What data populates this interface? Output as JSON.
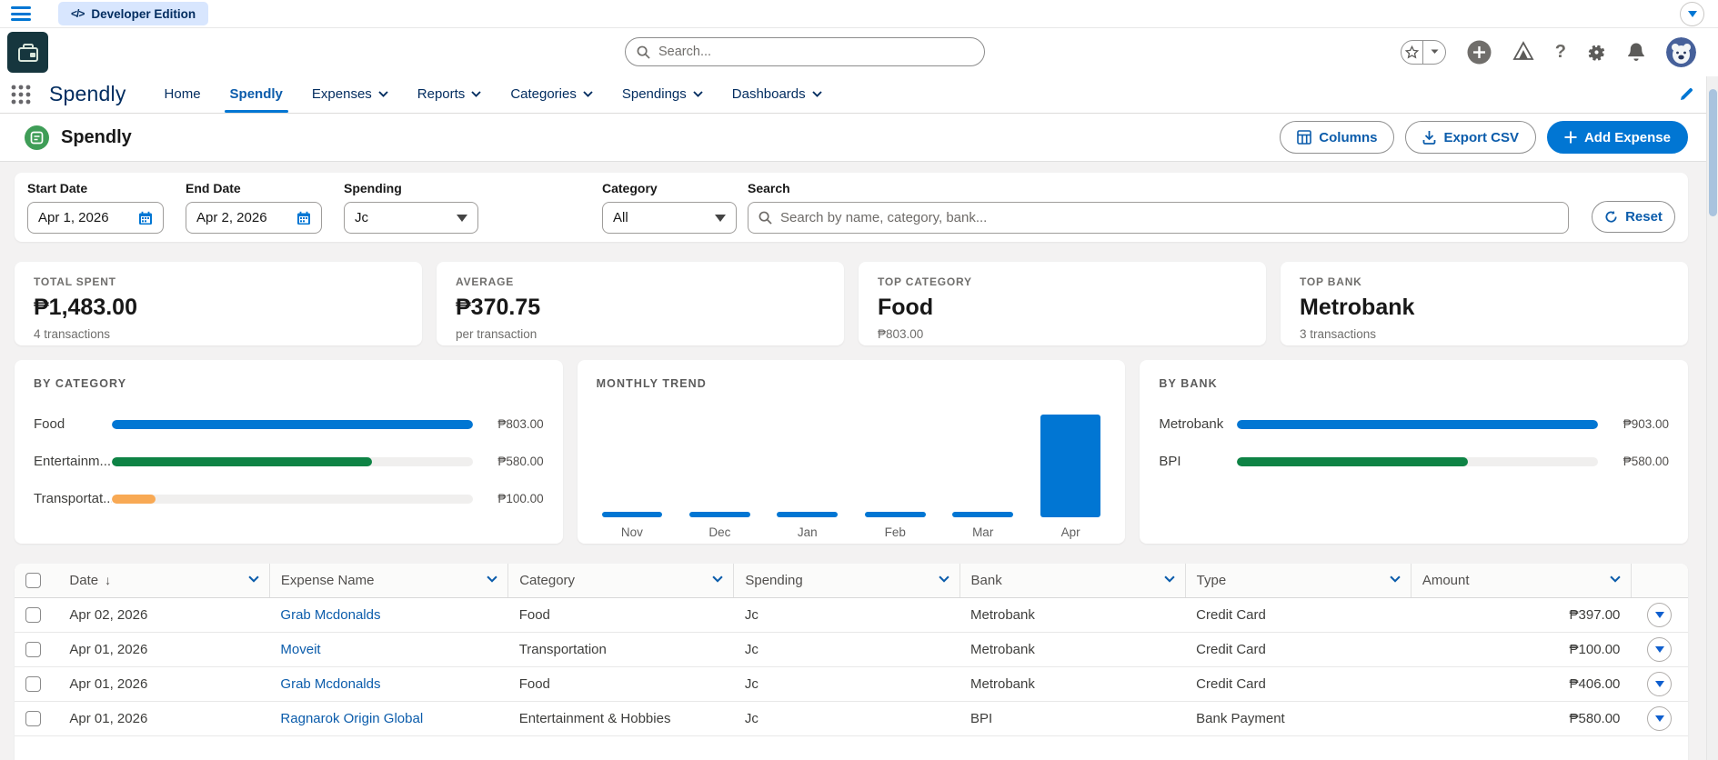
{
  "top_bar": {
    "developer_edition_label": "Developer Edition"
  },
  "global_header": {
    "search_placeholder": "Search..."
  },
  "nav": {
    "app_name": "Spendly",
    "tabs": [
      {
        "label": "Home",
        "active": false,
        "has_menu": false
      },
      {
        "label": "Spendly",
        "active": true,
        "has_menu": false
      },
      {
        "label": "Expenses",
        "active": false,
        "has_menu": true
      },
      {
        "label": "Reports",
        "active": false,
        "has_menu": true
      },
      {
        "label": "Categories",
        "active": false,
        "has_menu": true
      },
      {
        "label": "Spendings",
        "active": false,
        "has_menu": true
      },
      {
        "label": "Dashboards",
        "active": false,
        "has_menu": true
      }
    ]
  },
  "page_header": {
    "title": "Spendly",
    "columns_button": "Columns",
    "export_button": "Export CSV",
    "add_button": "Add Expense"
  },
  "filters": {
    "start_date": {
      "label": "Start Date",
      "value": "Apr 1, 2026"
    },
    "end_date": {
      "label": "End Date",
      "value": "Apr 2, 2026"
    },
    "spending": {
      "label": "Spending",
      "value": "Jc"
    },
    "category": {
      "label": "Category",
      "value": "All"
    },
    "search": {
      "label": "Search",
      "placeholder": "Search by name, category, bank..."
    },
    "reset_label": "Reset"
  },
  "stats": [
    {
      "label": "TOTAL SPENT",
      "value": "₱1,483.00",
      "sub": "4 transactions"
    },
    {
      "label": "AVERAGE",
      "value": "₱370.75",
      "sub": "per transaction"
    },
    {
      "label": "TOP CATEGORY",
      "value": "Food",
      "sub": "₱803.00"
    },
    {
      "label": "TOP BANK",
      "value": "Metrobank",
      "sub": "3 transactions"
    }
  ],
  "chart_data": [
    {
      "type": "bar",
      "orientation": "horizontal",
      "title": "BY CATEGORY",
      "categories": [
        "Food",
        "Entertainm...",
        "Transportat..."
      ],
      "values": [
        803,
        580,
        100
      ],
      "value_labels": [
        "₱803.00",
        "₱580.00",
        "₱100.00"
      ],
      "bar_colors": [
        "#0176d3",
        "#0e8345",
        "#f8a954"
      ],
      "xmax": 803,
      "grid": false,
      "legend": false
    },
    {
      "type": "bar",
      "orientation": "vertical",
      "title": "MONTHLY TREND",
      "categories": [
        "Nov",
        "Dec",
        "Jan",
        "Feb",
        "Mar",
        "Apr"
      ],
      "values": [
        0,
        0,
        0,
        0,
        0,
        1483
      ],
      "bar_color": "#0176d3",
      "ylim": [
        0,
        1483
      ],
      "grid": false,
      "legend": false
    },
    {
      "type": "bar",
      "orientation": "horizontal",
      "title": "BY BANK",
      "categories": [
        "Metrobank",
        "BPI"
      ],
      "values": [
        903,
        580
      ],
      "value_labels": [
        "₱903.00",
        "₱580.00"
      ],
      "bar_colors": [
        "#0176d3",
        "#0e8345"
      ],
      "xmax": 903,
      "grid": false,
      "legend": false
    }
  ],
  "table": {
    "columns": [
      {
        "label": "Date",
        "sort_arrow": "↓"
      },
      {
        "label": "Expense Name"
      },
      {
        "label": "Category"
      },
      {
        "label": "Spending"
      },
      {
        "label": "Bank"
      },
      {
        "label": "Type"
      },
      {
        "label": "Amount"
      }
    ],
    "rows": [
      {
        "date": "Apr 02, 2026",
        "name": "Grab Mcdonalds",
        "category": "Food",
        "spending": "Jc",
        "bank": "Metrobank",
        "type": "Credit Card",
        "amount": "₱397.00"
      },
      {
        "date": "Apr 01, 2026",
        "name": "Moveit",
        "category": "Transportation",
        "spending": "Jc",
        "bank": "Metrobank",
        "type": "Credit Card",
        "amount": "₱100.00"
      },
      {
        "date": "Apr 01, 2026",
        "name": "Grab Mcdonalds",
        "category": "Food",
        "spending": "Jc",
        "bank": "Metrobank",
        "type": "Credit Card",
        "amount": "₱406.00"
      },
      {
        "date": "Apr 01, 2026",
        "name": "Ragnarok Origin Global",
        "category": "Entertainment & Hobbies",
        "spending": "Jc",
        "bank": "BPI",
        "type": "Bank Payment",
        "amount": "₱580.00"
      }
    ]
  },
  "colors": {
    "brand_blue": "#0176d3",
    "link_blue": "#0b5cab",
    "green": "#0e8345",
    "orange": "#f8a954"
  }
}
